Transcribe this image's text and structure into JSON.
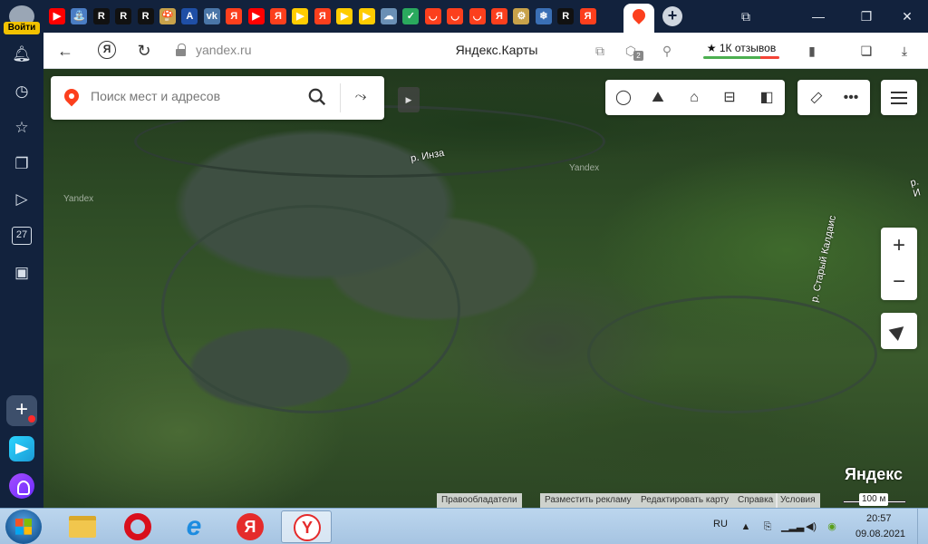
{
  "sidebar": {
    "login_label": "Войти",
    "calendar_day": "27",
    "icons": [
      "bell-icon",
      "clock-icon",
      "star-icon",
      "collections-icon",
      "play-icon",
      "calendar-icon",
      "screenshot-icon",
      "add-icon",
      "send-icon",
      "alice-icon"
    ]
  },
  "tabs": {
    "favicons": [
      {
        "glyph": "▶",
        "color": "#ff0000"
      },
      {
        "glyph": "⛲",
        "color": "#4a7dc4"
      },
      {
        "glyph": "R",
        "color": "#111111"
      },
      {
        "glyph": "R",
        "color": "#111111"
      },
      {
        "glyph": "R",
        "color": "#111111"
      },
      {
        "glyph": "🍄",
        "color": "#c8a24a"
      },
      {
        "glyph": "A",
        "color": "#1f4fa6"
      },
      {
        "glyph": "vk",
        "color": "#4a76a8"
      },
      {
        "glyph": "Я",
        "color": "#fc3f1d"
      },
      {
        "glyph": "▶",
        "color": "#ff0000"
      },
      {
        "glyph": "Я",
        "color": "#fc3f1d"
      },
      {
        "glyph": "▶",
        "color": "#ffcc00"
      },
      {
        "glyph": "Я",
        "color": "#fc3f1d"
      },
      {
        "glyph": "▶",
        "color": "#ffcc00"
      },
      {
        "glyph": "▶",
        "color": "#ffcc00"
      },
      {
        "glyph": "☁",
        "color": "#6a8fb5"
      },
      {
        "glyph": "✓",
        "color": "#2aa95e"
      },
      {
        "glyph": "◡",
        "color": "#fc3f1d"
      },
      {
        "glyph": "◡",
        "color": "#fc3f1d"
      },
      {
        "glyph": "◡",
        "color": "#fc3f1d"
      },
      {
        "glyph": "Я",
        "color": "#fc3f1d"
      },
      {
        "glyph": "⚙",
        "color": "#c8a24a"
      },
      {
        "glyph": "❄",
        "color": "#3a6fb5"
      },
      {
        "glyph": "R",
        "color": "#111111"
      },
      {
        "glyph": "Я",
        "color": "#fc3f1d"
      }
    ],
    "window_controls": [
      "collections-icon",
      "minimize-icon",
      "restore-icon",
      "close-icon"
    ]
  },
  "addressbar": {
    "domain": "yandex.ru",
    "page_title": "Яндекс.Карты",
    "reviews_label": "★ 1К отзывов",
    "protect_badge": "2"
  },
  "map": {
    "search_placeholder": "Поиск мест и адресов",
    "watermarks": [
      "Yandex",
      "Yandex"
    ],
    "river_labels": [
      "р. Инза",
      "р. Старый Калдаис",
      "р. И"
    ],
    "logo": "Яндекс",
    "footer_links": [
      "Правообладатели",
      "Разместить рекламу",
      "Редактировать карту",
      "Справка",
      "Условия"
    ],
    "scale_label": "100 м",
    "zoom_in": "+",
    "zoom_out": "−"
  },
  "taskbar": {
    "language": "RU",
    "time": "20:57",
    "date": "09.08.2021"
  }
}
